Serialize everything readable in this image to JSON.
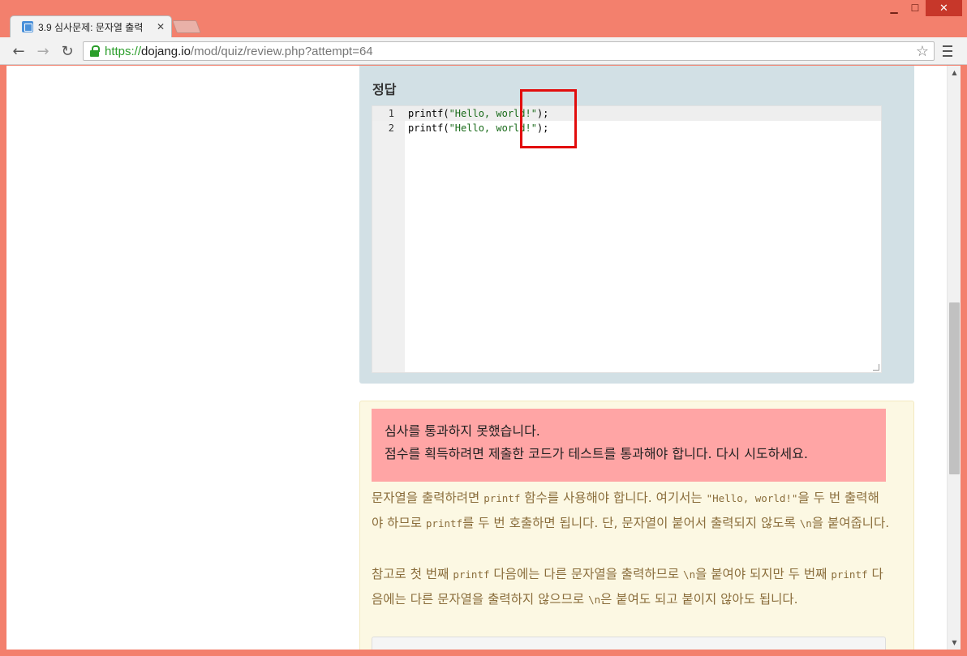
{
  "browser": {
    "tab_title": "3.9 심사문제: 문자열 출력",
    "url_scheme": "https://",
    "url_host": "dojang.io",
    "url_path": "/mod/quiz/review.php?attempt=64"
  },
  "answer": {
    "title": "정답",
    "lines": [
      {
        "num": "1",
        "fn": "printf(",
        "str": "\"Hello, world!\"",
        "end": ");"
      },
      {
        "num": "2",
        "fn": "printf(",
        "str": "\"Hello, world!\"",
        "end": ");"
      }
    ]
  },
  "feedback": {
    "alert_line1": "심사를 통과하지 못했습니다.",
    "alert_line2": "점수를 획득하려면 제출한 코드가 테스트를 통과해야 합니다. 다시 시도하세요.",
    "p1_a": "문자열을 출력하려면 ",
    "p1_code1": "printf",
    "p1_b": " 함수를 사용해야 합니다. 여기서는 ",
    "p1_code2": "\"Hello, world!\"",
    "p1_c": "을 두 번 출력해야 하므로 ",
    "p1_code3": "printf",
    "p1_d": "를 두 번 호출하면 됩니다. 단, 문자열이 붙어서 출력되지 않도록 ",
    "p1_code4": "\\n",
    "p1_e": "을 붙여줍니다.",
    "p2_a": "참고로 첫 번째 ",
    "p2_code1": "printf",
    "p2_b": " 다음에는 다른 문자열을 출력하므로 ",
    "p2_code2": "\\n",
    "p2_c": "을 붙여야 되지만 두 번째 ",
    "p2_code3": "printf",
    "p2_d": " 다음에는 다른 문자열을 출력하지 않으므로 ",
    "p2_code4": "\\n",
    "p2_e": "은 붙여도 되고 붙이지 않아도 됩니다."
  }
}
